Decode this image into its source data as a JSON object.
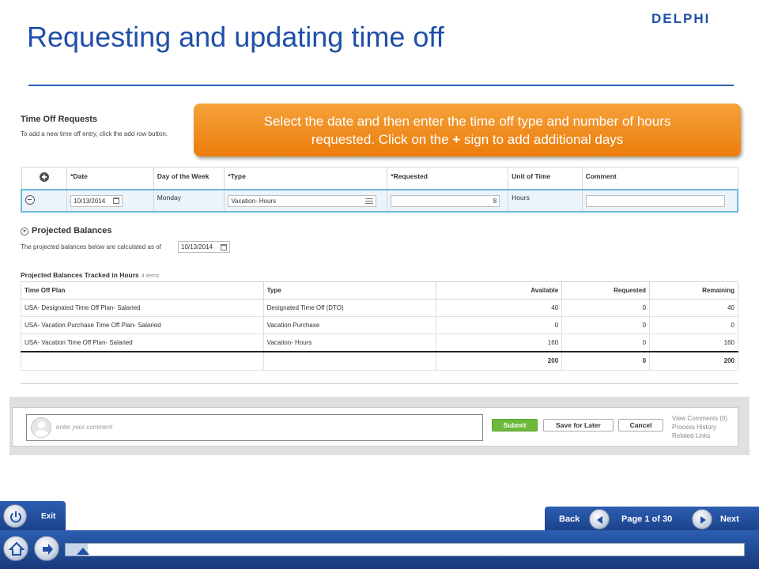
{
  "slide": {
    "title": "Requesting and updating time off",
    "logo_text": "DELPHI"
  },
  "time_off_requests": {
    "heading": "Time Off Requests",
    "instruction": "To add a new time off entry, click the add row button.",
    "columns": [
      "*Date",
      "Day of the Week",
      "*Type",
      "*Requested",
      "Unit of Time",
      "Comment"
    ],
    "row": {
      "date": "10/13/2014",
      "day_of_week": "Monday",
      "type": "Vacation- Hours",
      "requested": "8",
      "unit_of_time": "Hours",
      "comment": ""
    }
  },
  "callout": {
    "line1": "Select the date and then enter the time off type and number of hours",
    "line2_prefix": "requested.  Click on the ",
    "line2_symbol": "+",
    "line2_suffix": " sign to add additional days"
  },
  "projected_balances": {
    "heading": "Projected Balances",
    "as_of_label": "The projected balances below are calculated as of",
    "as_of_date": "10/13/2014",
    "table_title": "Projected Balances Tracked in Hours",
    "item_count": "4 items",
    "columns": [
      "Time Off Plan",
      "Type",
      "Available",
      "Requested",
      "Remaining"
    ],
    "rows": [
      {
        "plan": "USA- Designated Time Off Plan- Salaried",
        "type": "Designated Time Off (DTO)",
        "available": "40",
        "requested": "0",
        "remaining": "40"
      },
      {
        "plan": "USA- Vacation Purchase Time Off Plan- Salaried",
        "type": "Vacation Purchase",
        "available": "0",
        "requested": "0",
        "remaining": "0"
      },
      {
        "plan": "USA- Vacation Time Off Plan- Salaried",
        "type": "Vacation- Hours",
        "available": "160",
        "requested": "0",
        "remaining": "160"
      }
    ],
    "totals": {
      "available": "200",
      "requested": "0",
      "remaining": "200"
    }
  },
  "comment_bar": {
    "placeholder": "enter your comment",
    "submit": "Submit",
    "save_for_later": "Save for Later",
    "cancel": "Cancel",
    "links": [
      "View Comments (0)",
      "Process History",
      "Related Links"
    ]
  },
  "navigation": {
    "exit": "Exit",
    "back": "Back",
    "next": "Next",
    "page_indicator": "Page 1 of 30",
    "progress_fraction": 0.033
  },
  "colors": {
    "title_blue": "#1f4fa8",
    "callout_orange": "#ec7c0b",
    "submit_green": "#6cba3c",
    "nav_blue": "#2c5db1"
  },
  "icons": [
    "add-row-icon",
    "remove-row-icon",
    "calendar-icon",
    "list-prompt-icon",
    "collapse-chevron-icon",
    "avatar-icon",
    "power-icon",
    "back-arrow-icon",
    "next-arrow-icon",
    "home-icon",
    "forward-arrow-icon"
  ]
}
